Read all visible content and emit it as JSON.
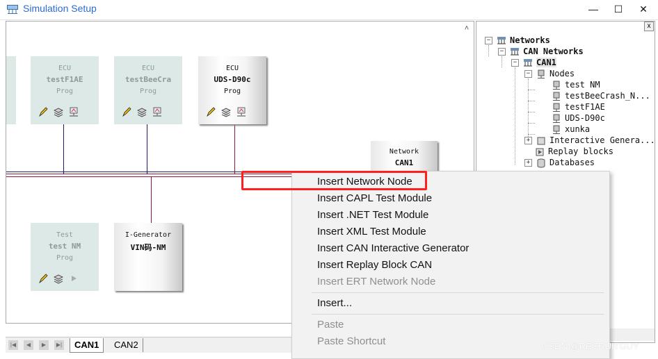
{
  "window": {
    "title": "Simulation Setup",
    "minimize_glyph": "—",
    "maximize_glyph": "☐",
    "close_glyph": "✕"
  },
  "canvas": {
    "nodes": [
      {
        "label1": "ECU",
        "label2": "testF1AE",
        "label3": "Prog"
      },
      {
        "label1": "ECU",
        "label2": "testBeeCra",
        "label3": "Prog"
      },
      {
        "label1": "ECU",
        "label2": "UDS-D90c",
        "label3": "Prog"
      },
      {
        "label1": "Network",
        "label2": "CAN1",
        "label3": ""
      },
      {
        "label1": "Test",
        "label2": "test NM",
        "label3": "Prog"
      },
      {
        "label1": "I-Generator",
        "label2": "VIN码-NM",
        "label3": ""
      }
    ],
    "scroll_up_glyph": "˄",
    "scroll_left_glyph": "<"
  },
  "tabs": [
    "CAN1",
    "CAN2"
  ],
  "tree": {
    "items": [
      {
        "label": "Networks"
      },
      {
        "label": "CAN Networks"
      },
      {
        "label": "CAN1"
      },
      {
        "label": "Nodes"
      },
      {
        "label": "test NM"
      },
      {
        "label": "testBeeCrash_N..."
      },
      {
        "label": "testF1AE"
      },
      {
        "label": "UDS-D90c"
      },
      {
        "label": "xunka"
      },
      {
        "label": "Interactive Genera..."
      },
      {
        "label": "Replay blocks"
      },
      {
        "label": "Databases"
      }
    ],
    "close_glyph": "x"
  },
  "context_menu": {
    "items": [
      {
        "label": "Insert Network Node",
        "enabled": true
      },
      {
        "label": "Insert CAPL Test Module",
        "enabled": true
      },
      {
        "label": "Insert .NET Test Module",
        "enabled": true
      },
      {
        "label": "Insert XML Test Module",
        "enabled": true
      },
      {
        "label": "Insert CAN Interactive Generator",
        "enabled": true
      },
      {
        "label": "Insert Replay Block CAN",
        "enabled": true
      },
      {
        "label": "Insert ERT Network Node",
        "enabled": false
      },
      {
        "label": "Insert...",
        "enabled": true
      },
      {
        "label": "Paste",
        "enabled": false
      },
      {
        "label": "Paste Shortcut",
        "enabled": false
      }
    ]
  },
  "watermark": "CSDN @RECRUITGUY",
  "colors": {
    "accent": "#2b6ad7",
    "bus_line": "#8b1a3a",
    "bus_line_2": "#1a1a6e",
    "highlight": "#ff1f1f",
    "node_inactive": "#dde9e6"
  }
}
